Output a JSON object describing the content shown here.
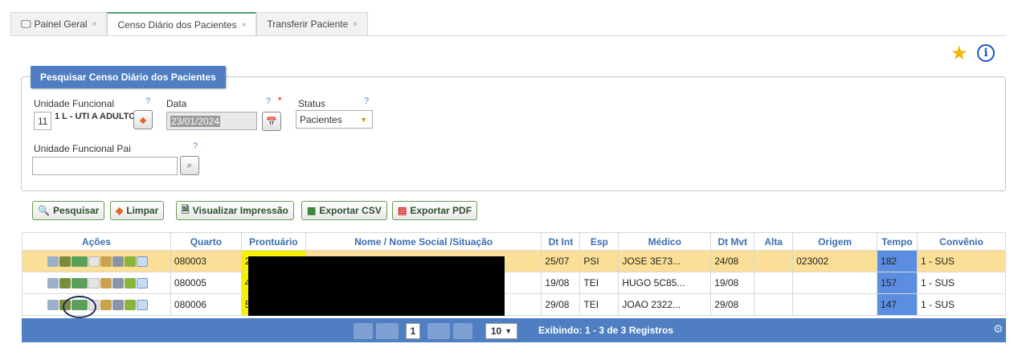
{
  "tabs": [
    {
      "label": "Painel Geral",
      "close": "×"
    },
    {
      "label": "Censo Diário dos Pacientes",
      "close": "×"
    },
    {
      "label": "Transferir Paciente",
      "close": "×"
    }
  ],
  "panel": {
    "title": "Pesquisar Censo Diário dos Pacientes",
    "unidade_label": "Unidade Funcional",
    "unidade_code": "11",
    "unidade_name": "1 L - UTI A ADULTO",
    "data_label": "Data",
    "data_value": "23/01/2024",
    "status_label": "Status",
    "status_value": "Pacientes",
    "pai_label": "Unidade Funcional Pai",
    "pai_value": "",
    "help": "?",
    "required": "*"
  },
  "buttons": {
    "pesquisar": "Pesquisar",
    "limpar": "Limpar",
    "visualizar": "Visualizar Impressão",
    "csv": "Exportar CSV",
    "pdf": "Exportar PDF"
  },
  "table": {
    "headers": [
      "Ações",
      "Quarto",
      "Prontuário",
      "Nome / Nome Social /Situação",
      "Dt Int",
      "Esp",
      "Médico",
      "Dt Mvt",
      "Alta",
      "Origem",
      "Tempo",
      "Convênio"
    ],
    "rows": [
      {
        "quarto": "080003",
        "prontuario": "2",
        "nome": "",
        "dt_int": "25/07",
        "esp": "PSI",
        "medico": "JOSE 3E73...",
        "dt_mvt": "24/08",
        "alta": "",
        "origem": "023002",
        "tempo": "182",
        "convenio": "1 - SUS"
      },
      {
        "quarto": "080005",
        "prontuario": "4",
        "nome": "",
        "dt_int": "19/08",
        "esp": "TEI",
        "medico": "HUGO 5C85...",
        "dt_mvt": "19/08",
        "alta": "",
        "origem": "",
        "tempo": "157",
        "convenio": "1 - SUS"
      },
      {
        "quarto": "080006",
        "prontuario": "5",
        "nome": "",
        "dt_int": "29/08",
        "esp": "TEI",
        "medico": "JOAO 2322...",
        "dt_mvt": "29/08",
        "alta": "",
        "origem": "",
        "tempo": "147",
        "convenio": "1 - SUS"
      }
    ]
  },
  "pager": {
    "current_page": "1",
    "page_size": "10",
    "summary": "Exibindo: 1 - 3 de 3 Registros"
  },
  "colors": {
    "accent": "#4f7ec2",
    "selected_row": "#fcdf96",
    "prontuario_highlight": "#f7ef00",
    "tempo": "#5b8de1",
    "star": "#f5b400"
  }
}
